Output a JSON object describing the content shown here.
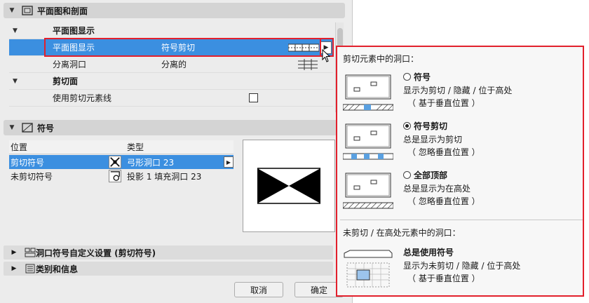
{
  "sections": {
    "floor_plan": {
      "title": "平面图和剖面"
    },
    "symbol": {
      "title": "符号"
    },
    "custom": {
      "title": "洞口符号自定义设置 (剪切符号)"
    },
    "category": {
      "title": "类别和信息"
    }
  },
  "rows": [
    {
      "key": "平面图显示",
      "value": ""
    },
    {
      "key": "平面图显示",
      "value": "符号剪切"
    },
    {
      "key": "分离洞口",
      "value": "分离的"
    },
    {
      "key": "剪切面",
      "value": ""
    },
    {
      "key": "使用剪切元素线",
      "value": ""
    }
  ],
  "symbol_table": {
    "headers": [
      "位置",
      "类型"
    ],
    "rows": [
      {
        "pos": "剪切符号",
        "type": "弓形洞口 23"
      },
      {
        "pos": "未剪切符号",
        "type": "投影 1 填充洞口 23"
      }
    ]
  },
  "popup": {
    "heading_cut": "剪切元素中的洞口：",
    "options": [
      {
        "label": "符号",
        "line1": "显示为剪切 / 隐藏 / 位于高处",
        "line2": "（ 基于垂直位置 ）",
        "selected": false
      },
      {
        "label": "符号剪切",
        "line1": "总是显示为剪切",
        "line2": "（ 忽略垂直位置 ）",
        "selected": true
      },
      {
        "label": "全部顶部",
        "line1": "总是显示为在高处",
        "line2": "（ 忽略垂直位置 ）",
        "selected": false
      }
    ],
    "heading_uncut": "未剪切 / 在高处元素中的洞口：",
    "always_symbol": {
      "label": "总是使用符号",
      "line1": "显示为未剪切 / 隐藏 / 位于高处",
      "line2": "（ 基于垂直位置 ）"
    }
  },
  "buttons": {
    "cancel": "取消",
    "ok": "确定"
  },
  "colors": {
    "selection": "#3b8fe0",
    "highlight_border": "#e2202c"
  }
}
